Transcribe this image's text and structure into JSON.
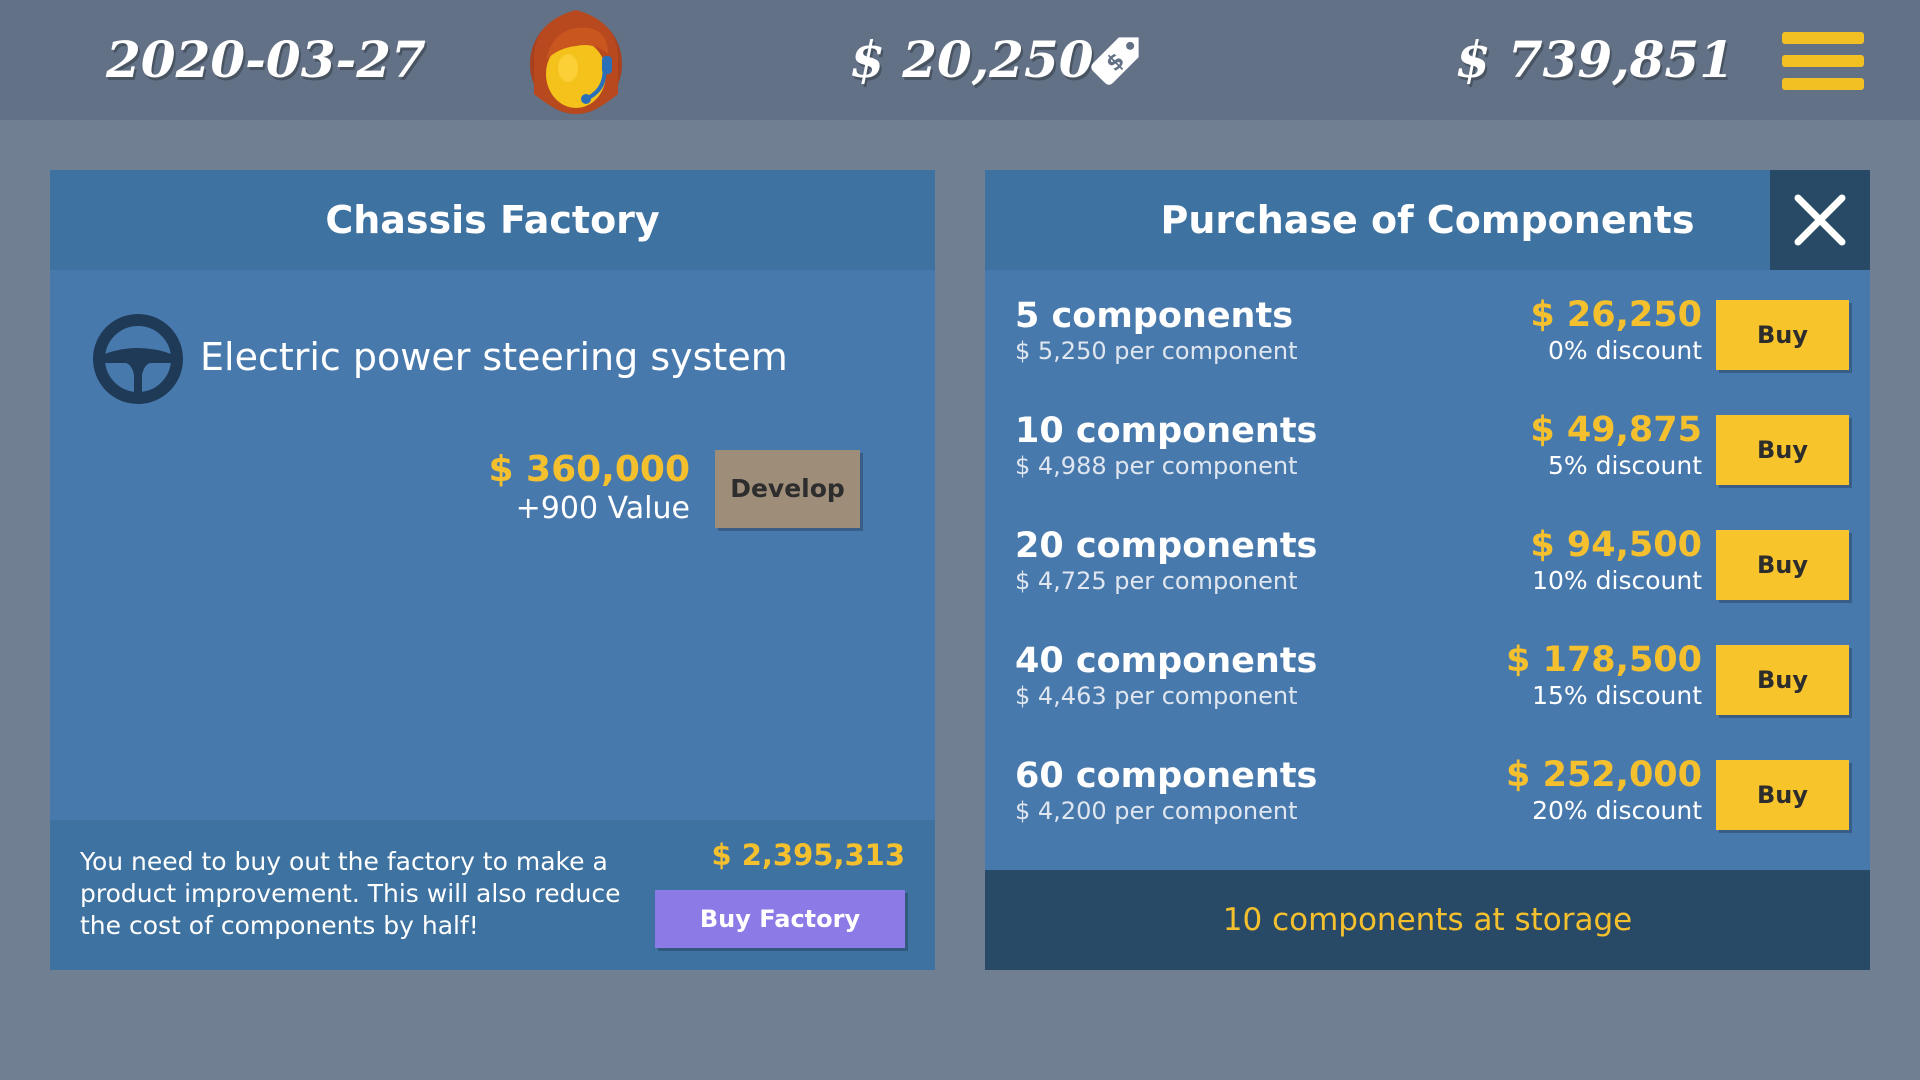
{
  "topbar": {
    "date": "2020-03-27",
    "weekly_amount": "$ 20,250",
    "balance": "$ 739,851",
    "avatar_icon": "assistant-avatar-icon",
    "tag_icon": "price-tag-icon",
    "menu_icon": "hamburger-menu-icon"
  },
  "factory_panel": {
    "title": "Chassis Factory",
    "improvement": {
      "icon": "steering-wheel-icon",
      "name": "Electric power steering system",
      "price": "$ 360,000",
      "value": "+900 Value",
      "develop_label": "Develop"
    },
    "footer": {
      "text": "You need to buy out the factory to make a product improvement. This will also reduce the cost of components by half!",
      "price": "$ 2,395,313",
      "buy_label": "Buy Factory"
    }
  },
  "purchase_panel": {
    "title": "Purchase of Components",
    "close_icon": "close-icon",
    "options": [
      {
        "quantity": "5 components",
        "unit_price": "$ 5,250 per component",
        "total": "$ 26,250",
        "discount": "0% discount",
        "buy_label": "Buy"
      },
      {
        "quantity": "10 components",
        "unit_price": "$ 4,988 per component",
        "total": "$ 49,875",
        "discount": "5% discount",
        "buy_label": "Buy"
      },
      {
        "quantity": "20 components",
        "unit_price": "$ 4,725 per component",
        "total": "$ 94,500",
        "discount": "10% discount",
        "buy_label": "Buy"
      },
      {
        "quantity": "40 components",
        "unit_price": "$ 4,463 per component",
        "total": "$ 178,500",
        "discount": "15% discount",
        "buy_label": "Buy"
      },
      {
        "quantity": "60 components",
        "unit_price": "$ 4,200 per component",
        "total": "$ 252,000",
        "discount": "20% discount",
        "buy_label": "Buy"
      }
    ],
    "storage": "10 components at storage"
  },
  "colors": {
    "background": "#717f93",
    "topbar": "#627185",
    "panel": "#4879ad",
    "panel_header": "#3e72a0",
    "dark_bar": "#294a66",
    "accent_yellow": "#f5c02e",
    "buy_button": "#f8c42c",
    "develop_button": "#9e8d78",
    "buy_factory_button": "#8c7ae6"
  }
}
